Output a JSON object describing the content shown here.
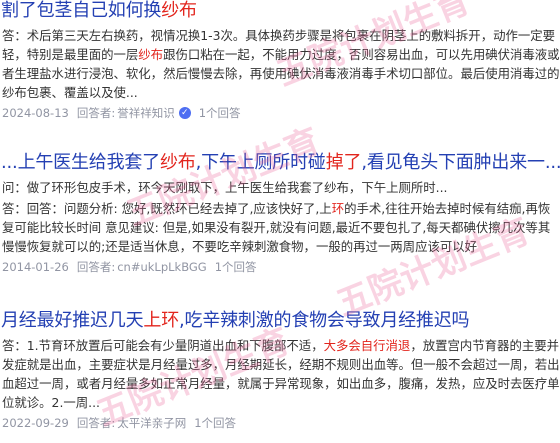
{
  "results": [
    {
      "title_segments": [
        {
          "text": "割了包茎自己如何换",
          "hl": false
        },
        {
          "text": "纱布",
          "hl": true
        }
      ],
      "body_segments": [
        {
          "text": "答：术后第三天左右换药，视情况换1-3次。具体换药步骤是将包裹在阴茎上的敷料拆开，动作一定要轻，特别是最里面的一层",
          "hl": false
        },
        {
          "text": "纱布",
          "hl": true
        },
        {
          "text": "跟伤口粘在一起，不能用力过度，否则容易出血，可以先用碘伏消毒液或者生理盐水进行浸泡、软化，然后慢慢去除，再使用碘伏消毒液消毒手术切口部位。最后使用消毒过的",
          "hl": false
        },
        {
          "text": "纱布",
          "hl": false
        },
        {
          "text": "包裹、覆盖以及使...",
          "hl": false
        }
      ],
      "date": "2024-08-13",
      "answerer_label": "回答者:",
      "answerer": "誉祥祥知识",
      "answer_count": "1个回答"
    },
    {
      "title_segments": [
        {
          "text": "...上午医生给我套了",
          "hl": false
        },
        {
          "text": "纱布",
          "hl": true
        },
        {
          "text": ",下午上厕所时碰",
          "hl": false
        },
        {
          "text": "掉了",
          "hl": true
        },
        {
          "text": ",看见龟头下面肿出来一...",
          "hl": false
        }
      ],
      "body_segments": [
        {
          "text": "问：做了环形包皮手术，环今天刚取下，上午医生给我套了纱布，下午上厕所时...",
          "hl": false
        }
      ],
      "body2_segments": [
        {
          "text": "答：回答：问题分析: 您好,既然环已经去掉了,应该快好了,上",
          "hl": false
        },
        {
          "text": "环",
          "hl": true
        },
        {
          "text": "的手术,往往开始去掉时候有结痂,再恢复可能比较长时间 意见建议: 但是,如果没有裂开,就没有问题,最近不要包扎了,每天都碘伏擦几次等其慢慢恢复就可以的;还是适当休息，不要吃辛辣刺激食物，一般的再过一两周应该可以好",
          "hl": false
        }
      ],
      "date": "2014-01-26",
      "answerer_label": "回答者:",
      "answerer": "cn#ukLpLkBGG",
      "answer_count": "1个回答"
    },
    {
      "title_segments": [
        {
          "text": "月经最好推迟几天",
          "hl": false
        },
        {
          "text": "上环",
          "hl": true
        },
        {
          "text": ",吃辛辣刺激的食物会导致月经推迟吗",
          "hl": false
        }
      ],
      "body_segments": [
        {
          "text": "答：1.节育环放置后可能会有少量阴道出血和下腹部不适，",
          "hl": false
        },
        {
          "text": "大多会自行消退",
          "hl": true
        },
        {
          "text": "，放置宫内节育器的主要并发症就是出血，主要症状是月经量过多，月经期延长，经期不规则出血等。但一般不会超过一周，若出血超过一周，或者月经量多如正常月经量，就属于异常现象，如出血多，腹痛，发热，应及时去医疗单位就诊。2.一周...",
          "hl": false
        }
      ],
      "date": "2022-09-29",
      "answerer_label": "回答者:",
      "answerer": "太平洋亲子网",
      "answer_count": "1个回答"
    }
  ],
  "watermark_text": "五院计划生育"
}
